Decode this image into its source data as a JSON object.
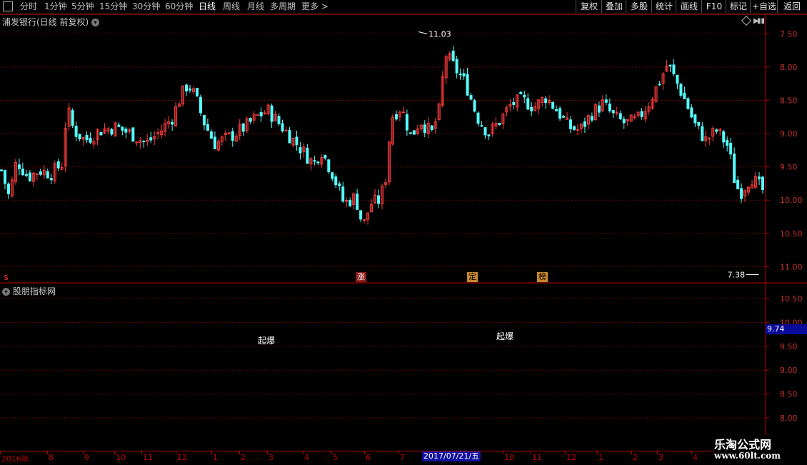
{
  "toolbar": {
    "periods": [
      "分时",
      "1分钟",
      "5分钟",
      "15分钟",
      "30分钟",
      "60分钟",
      "日线",
      "周线",
      "月线",
      "多周期",
      "更多 >"
    ],
    "active_period": "日线",
    "buttons": [
      "复权",
      "叠加",
      "多股",
      "统计",
      "画线",
      "F10",
      "标记",
      "+自选",
      "返回"
    ]
  },
  "main_chart": {
    "title": "浦发银行(日线 前复权)",
    "high_label": "11.03",
    "low_label": "7.38",
    "y_ticks": [
      "11.00",
      "10.50",
      "10.00",
      "9.50",
      "9.00",
      "8.50",
      "8.00",
      "7.50"
    ],
    "markers": [
      {
        "text": "$",
        "color": "#ff3030"
      },
      {
        "text": "涨",
        "color": "#ff8080"
      },
      {
        "text": "定",
        "color": "#ffb040"
      },
      {
        "text": "榜",
        "color": "#ffb040"
      }
    ]
  },
  "sub_chart": {
    "title": "股朋指标网",
    "y_ticks": [
      "10.50",
      "10.00",
      "9.50",
      "9.00",
      "8.50",
      "8.00"
    ],
    "current_value": "9.74",
    "signals": [
      "起爆",
      "起爆"
    ]
  },
  "date_axis": {
    "labels": [
      "2016年",
      "8",
      "9",
      "10",
      "11",
      "12",
      "1",
      "2",
      "3",
      "4",
      "5",
      "6",
      "7",
      "10",
      "11",
      "12",
      "1",
      "2",
      "3",
      "4"
    ],
    "highlight": "2017/07/21/五"
  },
  "watermark": {
    "title": "乐淘公式网",
    "url": "www.60lt.com"
  },
  "colors": {
    "up": "#ff3c3c",
    "down": "#54ffff",
    "grid": "#7a0000",
    "axis": "#c00000"
  },
  "chart_data": {
    "type": "candlestick",
    "title": "浦发银行(日线 前复权)",
    "x_range": [
      "2016-07",
      "2017-04"
    ],
    "ylim": [
      7.3,
      11.1
    ],
    "y_ticks": [
      7.5,
      8.0,
      8.5,
      9.0,
      9.5,
      10.0,
      10.5,
      11.0
    ],
    "high": 11.03,
    "low": 7.38,
    "close_path": [
      [
        0.0,
        8.95
      ],
      [
        0.01,
        8.55
      ],
      [
        0.02,
        9.1
      ],
      [
        0.035,
        8.85
      ],
      [
        0.05,
        8.95
      ],
      [
        0.065,
        8.9
      ],
      [
        0.08,
        9.05
      ],
      [
        0.086,
        9.9
      ],
      [
        0.095,
        9.55
      ],
      [
        0.11,
        9.4
      ],
      [
        0.13,
        9.55
      ],
      [
        0.15,
        9.6
      ],
      [
        0.17,
        9.5
      ],
      [
        0.19,
        9.35
      ],
      [
        0.21,
        9.55
      ],
      [
        0.225,
        9.75
      ],
      [
        0.235,
        10.05
      ],
      [
        0.245,
        10.25
      ],
      [
        0.255,
        10.05
      ],
      [
        0.265,
        9.7
      ],
      [
        0.28,
        9.35
      ],
      [
        0.3,
        9.45
      ],
      [
        0.32,
        9.6
      ],
      [
        0.335,
        9.75
      ],
      [
        0.35,
        9.85
      ],
      [
        0.365,
        9.65
      ],
      [
        0.38,
        9.45
      ],
      [
        0.395,
        9.25
      ],
      [
        0.41,
        9.05
      ],
      [
        0.42,
        9.25
      ],
      [
        0.435,
        8.9
      ],
      [
        0.45,
        8.45
      ],
      [
        0.465,
        8.55
      ],
      [
        0.475,
        8.1
      ],
      [
        0.485,
        8.45
      ],
      [
        0.497,
        8.5
      ],
      [
        0.505,
        8.85
      ],
      [
        0.512,
        9.75
      ],
      [
        0.525,
        9.9
      ],
      [
        0.538,
        9.45
      ],
      [
        0.55,
        9.7
      ],
      [
        0.565,
        9.5
      ],
      [
        0.575,
        9.85
      ],
      [
        0.583,
        10.7
      ],
      [
        0.595,
        10.5
      ],
      [
        0.61,
        10.25
      ],
      [
        0.625,
        9.75
      ],
      [
        0.64,
        9.5
      ],
      [
        0.655,
        9.7
      ],
      [
        0.67,
        9.95
      ],
      [
        0.685,
        10.0
      ],
      [
        0.7,
        9.9
      ],
      [
        0.715,
        10.05
      ],
      [
        0.73,
        9.85
      ],
      [
        0.745,
        9.6
      ],
      [
        0.76,
        9.55
      ],
      [
        0.775,
        9.8
      ],
      [
        0.79,
        9.95
      ],
      [
        0.805,
        9.75
      ],
      [
        0.82,
        9.65
      ],
      [
        0.835,
        9.7
      ],
      [
        0.85,
        9.95
      ],
      [
        0.865,
        10.3
      ],
      [
        0.875,
        10.55
      ],
      [
        0.89,
        10.2
      ],
      [
        0.9,
        9.95
      ],
      [
        0.91,
        9.65
      ],
      [
        0.925,
        9.4
      ],
      [
        0.94,
        9.55
      ],
      [
        0.955,
        9.3
      ],
      [
        0.963,
        8.8
      ],
      [
        0.97,
        8.6
      ],
      [
        0.985,
        8.85
      ],
      [
        1.0,
        8.65
      ],
      [
        1.005,
        8.05
      ],
      [
        1.015,
        7.85
      ],
      [
        1.03,
        7.95
      ],
      [
        1.045,
        7.75
      ],
      [
        1.06,
        7.45
      ],
      [
        1.072,
        7.5
      ]
    ]
  }
}
